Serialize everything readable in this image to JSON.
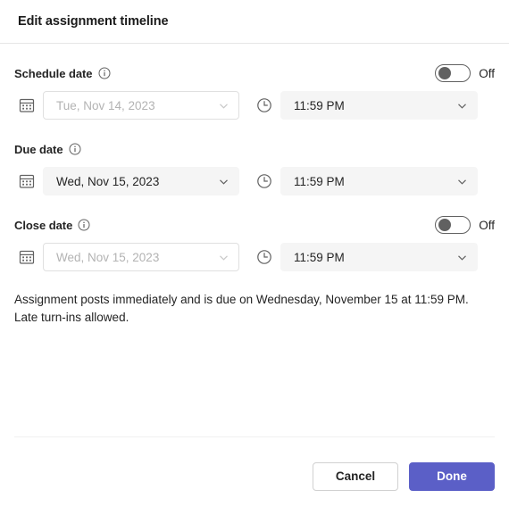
{
  "dialog": {
    "title": "Edit assignment timeline"
  },
  "groups": [
    {
      "key": "schedule",
      "label": "Schedule date",
      "info_icon": "info-icon",
      "has_toggle": true,
      "toggle_state": "off",
      "toggle_label": "Off",
      "date": {
        "icon": "calendar-icon",
        "value": "Tue, Nov 14, 2023",
        "placeholder": "Tue, Nov 14, 2023",
        "enabled": false
      },
      "time": {
        "icon": "clock-icon",
        "value": "11:59 PM",
        "placeholder": "11:59 PM",
        "enabled": true
      }
    },
    {
      "key": "due",
      "label": "Due date",
      "info_icon": "info-icon",
      "has_toggle": false,
      "toggle_state": "",
      "toggle_label": "",
      "date": {
        "icon": "calendar-icon",
        "value": "Wed, Nov 15, 2023",
        "placeholder": "Wed, Nov 15, 2023",
        "enabled": true
      },
      "time": {
        "icon": "clock-icon",
        "value": "11:59 PM",
        "placeholder": "11:59 PM",
        "enabled": true
      }
    },
    {
      "key": "close",
      "label": "Close date",
      "info_icon": "info-icon",
      "has_toggle": true,
      "toggle_state": "off",
      "toggle_label": "Off",
      "date": {
        "icon": "calendar-icon",
        "value": "Wed, Nov 15, 2023",
        "placeholder": "Wed, Nov 15, 2023",
        "enabled": false
      },
      "time": {
        "icon": "clock-icon",
        "value": "11:59 PM",
        "placeholder": "11:59 PM",
        "enabled": true
      }
    }
  ],
  "summary": {
    "line1": "Assignment posts immediately and is due on Wednesday, November 15 at 11:59 PM.",
    "line2": "Late turn-ins allowed."
  },
  "footer": {
    "cancel_label": "Cancel",
    "done_label": "Done"
  },
  "colors": {
    "accent": "#5b5fc7",
    "field_fill": "#f5f5f5",
    "field_border": "#e0e0e0",
    "disabled_text": "#b3b3b3",
    "text": "#242424"
  }
}
